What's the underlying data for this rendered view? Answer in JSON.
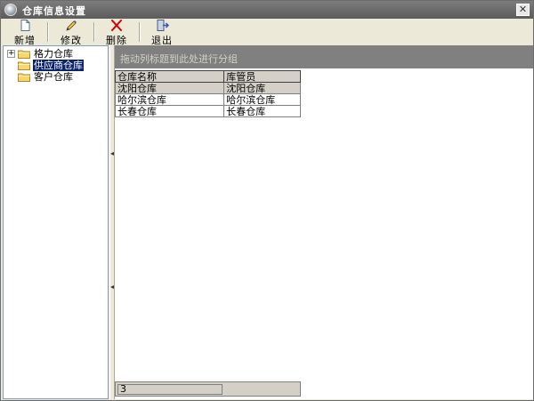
{
  "window": {
    "title": "仓库信息设置",
    "close_label": "✕"
  },
  "toolbar": {
    "items": [
      {
        "label": "新增",
        "icon": "new-document-icon"
      },
      {
        "label": "修改",
        "icon": "edit-pencil-icon"
      },
      {
        "label": "删除",
        "icon": "delete-x-icon"
      },
      {
        "label": "退出",
        "icon": "exit-door-icon"
      }
    ]
  },
  "tree": {
    "items": [
      {
        "label": "格力仓库",
        "expander": "+",
        "selected": false
      },
      {
        "label": "供应商仓库",
        "expander": "",
        "selected": true
      },
      {
        "label": "客户仓库",
        "expander": "",
        "selected": false
      }
    ]
  },
  "grid": {
    "group_hint": "拖动列标题到此处进行分组",
    "columns": [
      "仓库名称",
      "库管员"
    ],
    "rows": [
      [
        "沈阳仓库",
        "沈阳仓库"
      ],
      [
        "哈尔滨仓库",
        "哈尔滨仓库"
      ],
      [
        "长春仓库",
        "长春仓库"
      ]
    ],
    "footer_count": "3"
  },
  "colors": {
    "accent_selected": "#0a246a",
    "group_area": "#808080",
    "titlebar": "#6b6b6b",
    "delete_red": "#d00000"
  }
}
